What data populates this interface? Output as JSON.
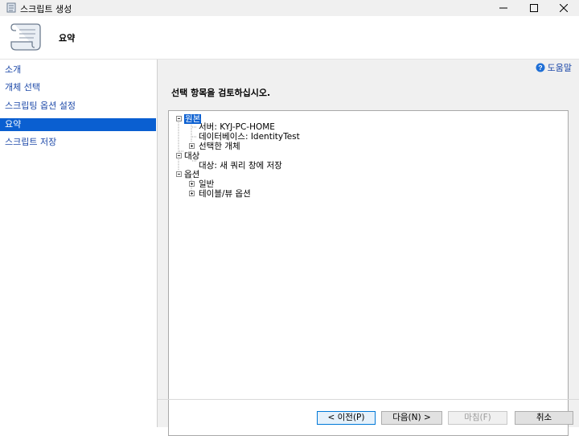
{
  "window": {
    "title": "스크립트 생성",
    "minimize_glyph": "–",
    "maximize_glyph": "□",
    "close_glyph": "✕"
  },
  "header": {
    "page_title": "요약",
    "icon": "scroll-icon"
  },
  "sidebar": {
    "items": [
      {
        "label": "소개",
        "active": false
      },
      {
        "label": "개체 선택",
        "active": false
      },
      {
        "label": "스크립팅 옵션 설정",
        "active": false
      },
      {
        "label": "요약",
        "active": true
      },
      {
        "label": "스크립트 저장",
        "active": false
      }
    ]
  },
  "main": {
    "help_label": "도움말",
    "instruction": "선택 항목을 검토하십시오."
  },
  "tree": {
    "source_label": "원본",
    "server": "서버: KYJ-PC-HOME",
    "database": "데이터베이스: IdentityTest",
    "selected_objects": "선택한 개체",
    "target_label": "대상",
    "target_value": "대상: 새 쿼리 창에 저장",
    "options_label": "옵션",
    "general": "일반",
    "table_view_options": "테이블/뷰 옵션"
  },
  "buttons": {
    "prev": "< 이전(P)",
    "next": "다음(N) >",
    "finish": "마침(F)",
    "cancel": "취소"
  },
  "colors": {
    "selection": "#0a5fd1",
    "link": "#1c48a8"
  }
}
